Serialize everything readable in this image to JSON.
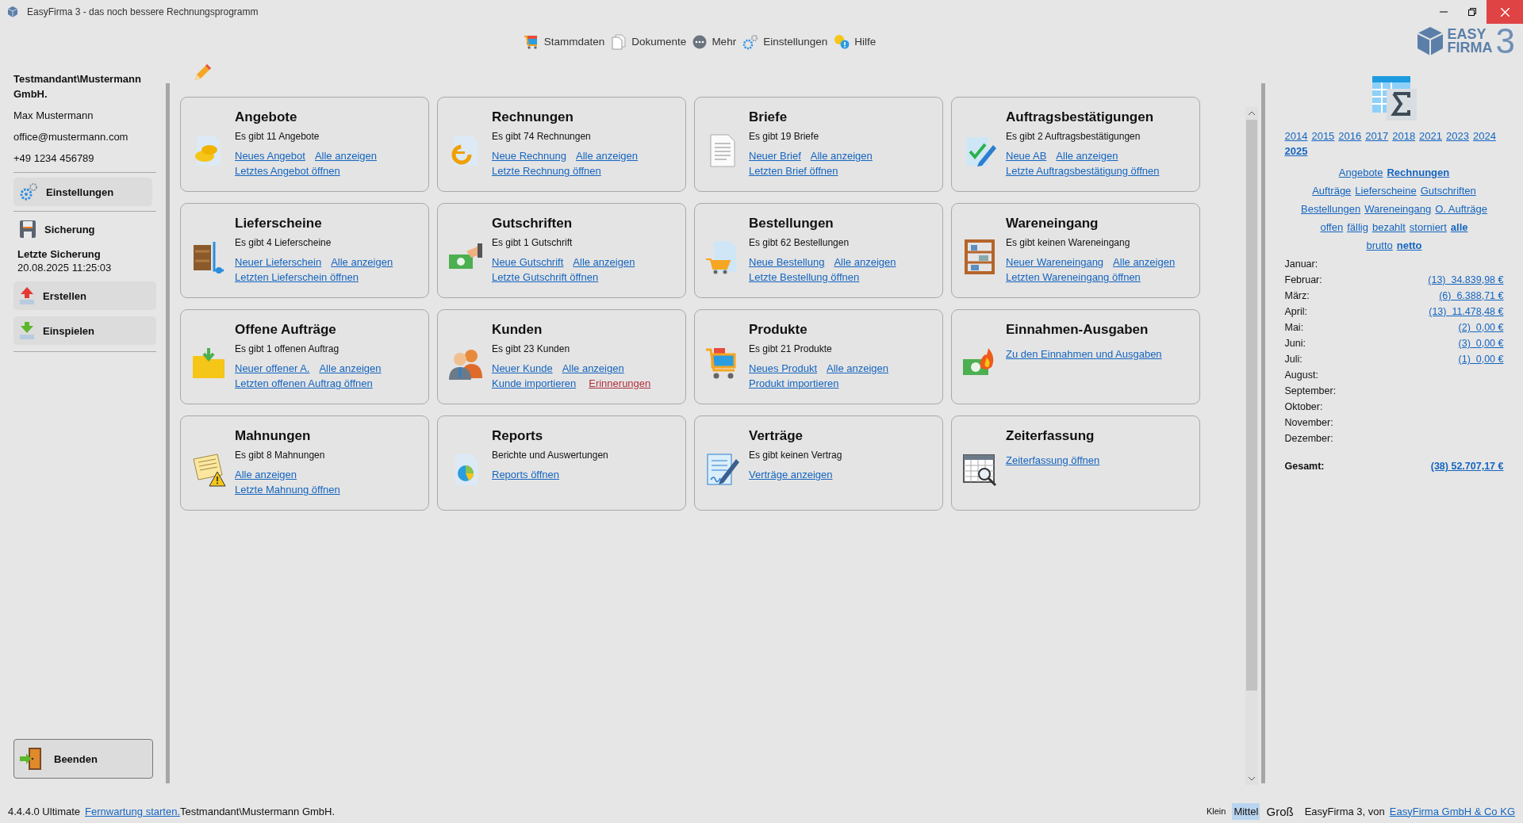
{
  "window": {
    "title": "EasyFirma 3 - das noch bessere Rechnungsprogramm"
  },
  "toolbar": [
    {
      "label": "Stammdaten",
      "kind": "cart"
    },
    {
      "label": "Dokumente",
      "kind": "docs"
    },
    {
      "label": "Mehr",
      "kind": "more"
    },
    {
      "label": "Einstellungen",
      "kind": "gear"
    },
    {
      "label": "Hilfe",
      "kind": "help"
    }
  ],
  "logo": {
    "line1": "EASY",
    "line2": "FIRMA",
    "number": "3"
  },
  "sidebar": {
    "company": "Testmandant\\Mustermann GmbH.",
    "name": "Max Mustermann",
    "email": "office@mustermann.com",
    "phone": "+49 1234 456789",
    "settings_button": "Einstellungen",
    "backup_heading": "Sicherung",
    "last_backup_label": "Letzte Sicherung",
    "last_backup_time": "20.08.2025 11:25:03",
    "create_button": "Erstellen",
    "restore_button": "Einspielen",
    "quit_button": "Beenden"
  },
  "cards": [
    {
      "title": "Angebote",
      "subtitle": "Es gibt 11 Angebote",
      "lines": [
        [
          {
            "text": "Neues Angebot",
            "warning": false
          },
          {
            "text": "Alle anzeigen",
            "warning": false
          }
        ],
        [
          {
            "text": "Letztes Angebot öffnen",
            "warning": false
          }
        ]
      ]
    },
    {
      "title": "Rechnungen",
      "subtitle": "Es gibt 74 Rechnungen",
      "lines": [
        [
          {
            "text": "Neue Rechnung",
            "warning": false
          },
          {
            "text": "Alle anzeigen",
            "warning": false
          }
        ],
        [
          {
            "text": "Letzte Rechnung öffnen",
            "warning": false
          }
        ]
      ]
    },
    {
      "title": "Briefe",
      "subtitle": "Es gibt 19 Briefe",
      "lines": [
        [
          {
            "text": "Neuer Brief",
            "warning": false
          },
          {
            "text": "Alle anzeigen",
            "warning": false
          }
        ],
        [
          {
            "text": "Letzten Brief öffnen",
            "warning": false
          }
        ]
      ]
    },
    {
      "title": "Auftragsbestätigungen",
      "subtitle": "Es gibt 2 Auftragsbestätigungen",
      "lines": [
        [
          {
            "text": "Neue AB",
            "warning": false
          },
          {
            "text": "Alle anzeigen",
            "warning": false
          }
        ],
        [
          {
            "text": "Letzte Auftragsbestätigung öffnen",
            "warning": false
          }
        ]
      ]
    },
    {
      "title": "Lieferscheine",
      "subtitle": "Es gibt 4 Lieferscheine",
      "lines": [
        [
          {
            "text": "Neuer Lieferschein",
            "warning": false
          },
          {
            "text": "Alle anzeigen",
            "warning": false
          }
        ],
        [
          {
            "text": "Letzten Lieferschein öffnen",
            "warning": false
          }
        ]
      ]
    },
    {
      "title": "Gutschriften",
      "subtitle": "Es gibt 1 Gutschrift",
      "lines": [
        [
          {
            "text": "Neue Gutschrift",
            "warning": false
          },
          {
            "text": "Alle anzeigen",
            "warning": false
          }
        ],
        [
          {
            "text": "Letzte Gutschrift öffnen",
            "warning": false
          }
        ]
      ]
    },
    {
      "title": "Bestellungen",
      "subtitle": "Es gibt 62 Bestellungen",
      "lines": [
        [
          {
            "text": "Neue Bestellung",
            "warning": false
          },
          {
            "text": "Alle anzeigen",
            "warning": false
          }
        ],
        [
          {
            "text": "Letzte Bestellung öffnen",
            "warning": false
          }
        ]
      ]
    },
    {
      "title": "Wareneingang",
      "subtitle": "Es gibt keinen Wareneingang",
      "lines": [
        [
          {
            "text": "Neuer Wareneingang",
            "warning": false
          },
          {
            "text": "Alle anzeigen",
            "warning": false
          }
        ],
        [
          {
            "text": "Letzten Wareneingang öffnen",
            "warning": false
          }
        ]
      ]
    },
    {
      "title": "Offene Aufträge",
      "subtitle": "Es gibt 1 offenen Auftrag",
      "lines": [
        [
          {
            "text": "Neuer offener A.",
            "warning": false
          },
          {
            "text": "Alle anzeigen",
            "warning": false
          }
        ],
        [
          {
            "text": "Letzten offenen Auftrag öffnen",
            "warning": false
          }
        ]
      ]
    },
    {
      "title": "Kunden",
      "subtitle": "Es gibt 23 Kunden",
      "lines": [
        [
          {
            "text": "Neuer Kunde",
            "warning": false
          },
          {
            "text": "Alle anzeigen",
            "warning": false
          }
        ],
        [
          {
            "text": "Kunde importieren",
            "warning": false
          },
          {
            "text": "Erinnerungen",
            "warning": true
          }
        ]
      ]
    },
    {
      "title": "Produkte",
      "subtitle": "Es gibt 21 Produkte",
      "lines": [
        [
          {
            "text": "Neues Produkt",
            "warning": false
          },
          {
            "text": "Alle anzeigen",
            "warning": false
          }
        ],
        [
          {
            "text": "Produkt importieren",
            "warning": false
          }
        ]
      ]
    },
    {
      "title": "Einnahmen-Ausgaben",
      "lines": [
        [
          {
            "text": "Zu den Einnahmen und Ausgaben",
            "warning": false
          }
        ]
      ]
    },
    {
      "title": "Mahnungen",
      "subtitle": "Es gibt 8 Mahnungen",
      "lines": [
        [
          {
            "text": "Alle anzeigen",
            "warning": false
          }
        ],
        [
          {
            "text": "Letzte Mahnung öffnen",
            "warning": false
          }
        ]
      ]
    },
    {
      "title": "Reports",
      "subtitle": "Berichte und Auswertungen",
      "lines": [
        [
          {
            "text": "Reports öffnen",
            "warning": false
          }
        ]
      ]
    },
    {
      "title": "Verträge",
      "subtitle": "Es gibt keinen Vertrag",
      "lines": [
        [
          {
            "text": "Verträge anzeigen",
            "warning": false
          }
        ]
      ]
    },
    {
      "title": "Zeiterfassung",
      "lines": [
        [
          {
            "text": "Zeiterfassung öffnen",
            "warning": false
          }
        ]
      ]
    }
  ],
  "stats": {
    "years": [
      {
        "label": "2014",
        "selected": false
      },
      {
        "label": "2015",
        "selected": false
      },
      {
        "label": "2016",
        "selected": false
      },
      {
        "label": "2017",
        "selected": false
      },
      {
        "label": "2018",
        "selected": false
      },
      {
        "label": "2021",
        "selected": false
      },
      {
        "label": "2023",
        "selected": false
      },
      {
        "label": "2024",
        "selected": false
      },
      {
        "label": "2025",
        "selected": true
      }
    ],
    "filter_rows": [
      [
        {
          "label": "Angebote",
          "selected": false
        },
        {
          "label": "Rechnungen",
          "selected": true
        }
      ],
      [
        {
          "label": "Aufträge",
          "selected": false
        },
        {
          "label": "Lieferscheine",
          "selected": false
        },
        {
          "label": "Gutschriften",
          "selected": false
        }
      ],
      [
        {
          "label": "Bestellungen",
          "selected": false
        },
        {
          "label": "Wareneingang",
          "selected": false
        },
        {
          "label": "O. Aufträge",
          "selected": false
        }
      ],
      [
        {
          "label": "offen",
          "selected": false
        },
        {
          "label": "fällig",
          "selected": false
        },
        {
          "label": "bezahlt",
          "selected": false
        },
        {
          "label": "storniert",
          "selected": false
        },
        {
          "label": "alle",
          "selected": true
        }
      ],
      [
        {
          "label": "brutto",
          "selected": false
        },
        {
          "label": "netto",
          "selected": true
        }
      ]
    ],
    "months": [
      {
        "month": "Januar:"
      },
      {
        "month": "Februar:",
        "value": "(13)  34.839,98 €"
      },
      {
        "month": "März:",
        "value": "(6)  6.388,71 €"
      },
      {
        "month": "April:",
        "value": "(13)  11.478,48 €"
      },
      {
        "month": "Mai:",
        "value": "(2)  0,00 €"
      },
      {
        "month": "Juni:",
        "value": "(3)  0,00 €"
      },
      {
        "month": "Juli:",
        "value": "(1)  0,00 €"
      },
      {
        "month": "August:"
      },
      {
        "month": "September:"
      },
      {
        "month": "Oktober:"
      },
      {
        "month": "November:"
      },
      {
        "month": "Dezember:"
      }
    ],
    "total_label": "Gesamt:",
    "total_value": "(38) 52.707,17 €"
  },
  "status_bar": {
    "version": "4.4.4.0 Ultimate",
    "remote_link": "Fernwartung starten.",
    "tenant": "Testmandant\\Mustermann GmbH.",
    "sizes": [
      {
        "label": "Klein",
        "selected": false
      },
      {
        "label": "Mittel",
        "selected": true
      },
      {
        "label": "Groß",
        "selected": false
      }
    ],
    "credit": "EasyFirma 3, von",
    "company_link": "EasyFirma GmbH & Co KG"
  }
}
